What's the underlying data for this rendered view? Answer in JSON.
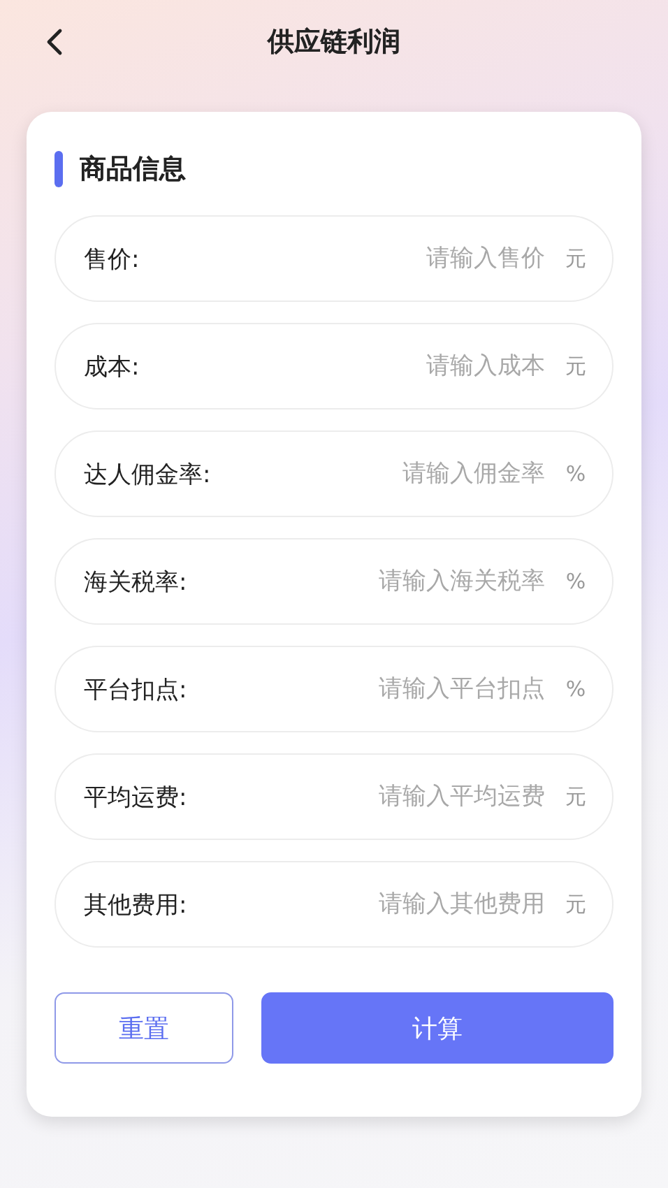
{
  "header": {
    "title": "供应链利润"
  },
  "section": {
    "title": "商品信息"
  },
  "fields": [
    {
      "label": "售价:",
      "placeholder": "请输入售价",
      "unit": "元"
    },
    {
      "label": "成本:",
      "placeholder": "请输入成本",
      "unit": "元"
    },
    {
      "label": "达人佣金率:",
      "placeholder": "请输入佣金率",
      "unit": "%"
    },
    {
      "label": "海关税率:",
      "placeholder": "请输入海关税率",
      "unit": "%"
    },
    {
      "label": "平台扣点:",
      "placeholder": "请输入平台扣点",
      "unit": "%"
    },
    {
      "label": "平均运费:",
      "placeholder": "请输入平均运费",
      "unit": "元"
    },
    {
      "label": "其他费用:",
      "placeholder": "请输入其他费用",
      "unit": "元"
    }
  ],
  "buttons": [
    {
      "label": "重置",
      "kind": "outline"
    },
    {
      "label": "计算",
      "kind": "primary"
    }
  ]
}
